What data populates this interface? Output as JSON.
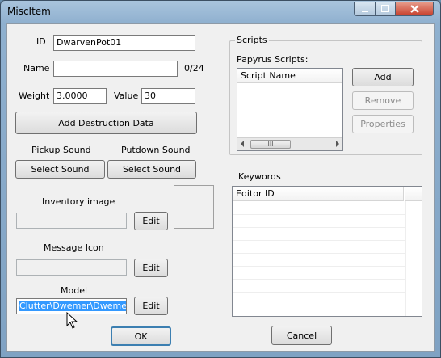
{
  "window": {
    "title": "MiscItem"
  },
  "fields": {
    "id_label": "ID",
    "id_value": "DwarvenPot01",
    "name_label": "Name",
    "name_value": "",
    "name_count": "0/24",
    "weight_label": "Weight",
    "weight_value": "3.0000",
    "value_label": "Value",
    "value_value": "30"
  },
  "buttons": {
    "add_destruction": "Add Destruction Data",
    "select_pickup": "Select Sound",
    "select_putdown": "Select Sound",
    "edit_inventory": "Edit",
    "edit_message": "Edit",
    "edit_model": "Edit",
    "ok": "OK",
    "cancel": "Cancel"
  },
  "sounds": {
    "pickup_label": "Pickup Sound",
    "putdown_label": "Putdown Sound"
  },
  "inventory": {
    "label": "Inventory image",
    "value": ""
  },
  "message": {
    "label": "Message Icon",
    "value": ""
  },
  "model": {
    "label": "Model",
    "value": "Clutter\\Dwemer\\DwemerPo"
  },
  "scripts": {
    "group_title": "Scripts",
    "list_label": "Papyrus Scripts:",
    "column": "Script Name",
    "add": "Add",
    "remove": "Remove",
    "properties": "Properties",
    "thumb_glyph": "III"
  },
  "keywords": {
    "label": "Keywords",
    "column": "Editor ID"
  },
  "colors": {
    "selection": "#3399ff",
    "titlebar": "#a9c4dd",
    "close": "#c7402d"
  }
}
